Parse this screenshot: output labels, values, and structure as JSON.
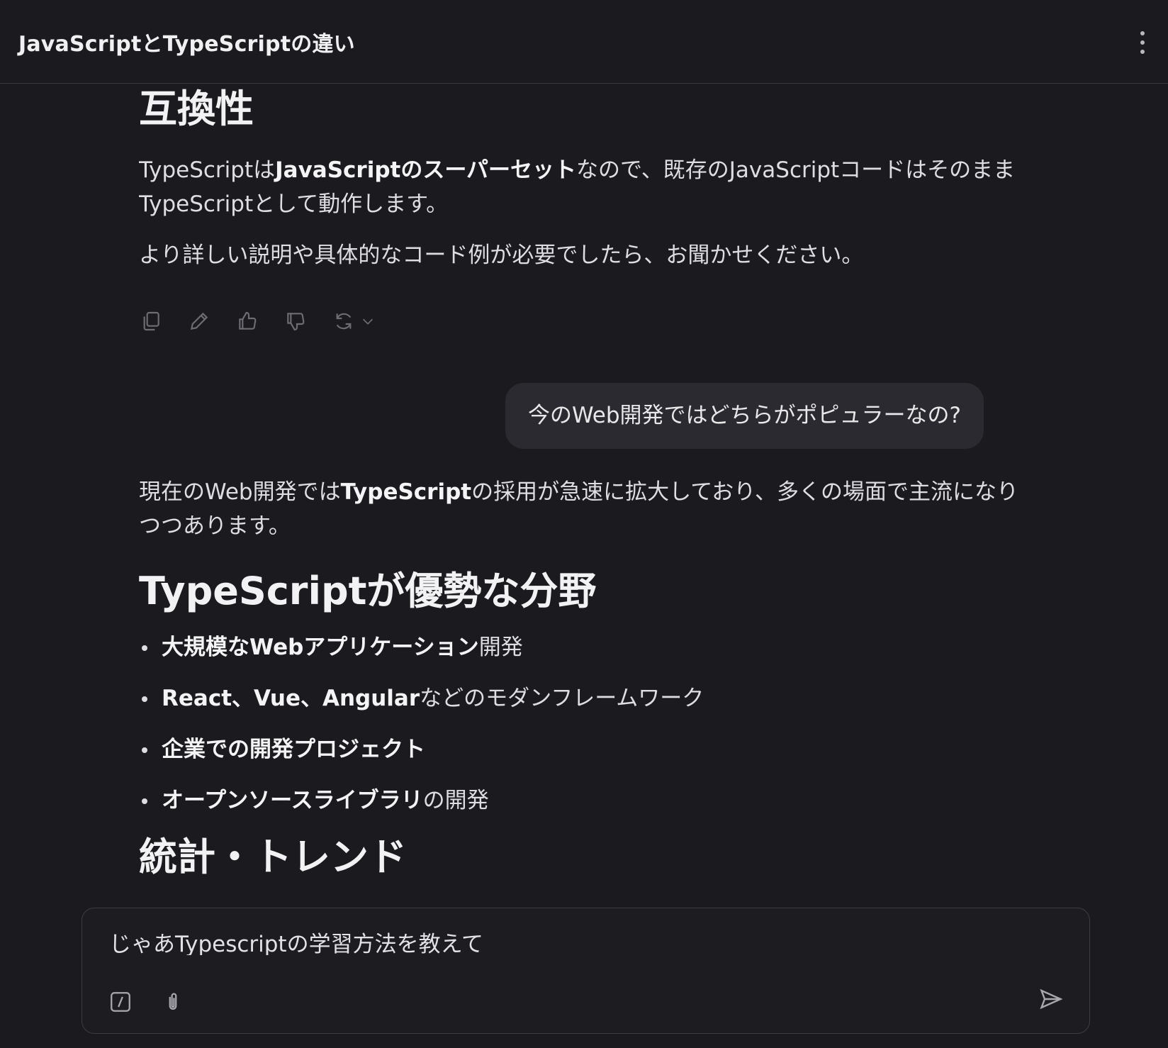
{
  "header": {
    "title": "JavaScriptとTypeScriptの違い",
    "menu_icon": "more-vertical-icon"
  },
  "messages": {
    "assistant_1": {
      "heading": "互換性",
      "para1_plain1": "TypeScriptは",
      "para1_bold": "JavaScriptのスーパーセット",
      "para1_plain2": "なので、既存のJavaScriptコードはそのまま",
      "para1_line2": "TypeScriptとして動作します。",
      "para2": "より詳しい説明や具体的なコード例が必要でしたら、お聞かせください。",
      "actions": {
        "copy_icon": "copy-icon",
        "edit_icon": "pencil-icon",
        "like_icon": "thumbs-up-icon",
        "dislike_icon": "thumbs-down-icon",
        "regenerate_icon": "refresh-icon",
        "chevron_icon": "chevron-down-icon"
      }
    },
    "user_1": {
      "text": "今のWeb開発ではどちらがポピュラーなの?"
    },
    "assistant_2": {
      "intro_plain1": "現在のWeb開発では",
      "intro_bold": "TypeScript",
      "intro_plain2": "の採用が急速に拡大しており、多くの場面で主流になり",
      "intro_line2": "つつあります。",
      "heading1": "TypeScriptが優勢な分野",
      "bullets": [
        {
          "bold": "大規模なWebアプリケーション",
          "plain": "開発"
        },
        {
          "bold": "React、Vue、Angular",
          "plain": "などのモダンフレームワーク"
        },
        {
          "bold": "企業での開発プロジェクト",
          "plain": ""
        },
        {
          "bold": "オープンソースライブラリ",
          "plain": "の開発"
        }
      ],
      "heading2": "統計・トレンド"
    }
  },
  "composer": {
    "value": "じゃあTypescriptの学習方法を教えて",
    "slash_icon": "slash-command-icon",
    "attach_icon": "paperclip-icon",
    "send_icon": "send-icon"
  }
}
